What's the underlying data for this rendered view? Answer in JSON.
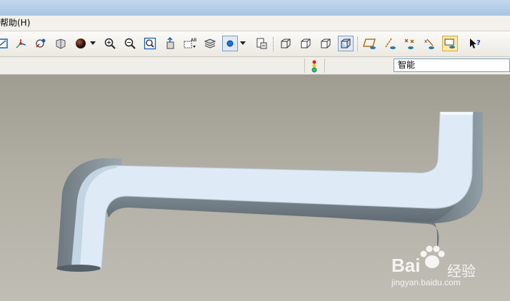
{
  "menu": {
    "help_label": "帮助(H)"
  },
  "toolbar": {
    "icons": [
      "sketch-icon",
      "datum-axis-icon",
      "spin-center-icon",
      "shading-icon",
      "appearance-sphere-icon",
      "zoom-in-icon",
      "zoom-out-icon",
      "refit-icon",
      "named-view-icon",
      "annotation-icon",
      "layers-icon",
      "spin-point-icon",
      "saved-view-icon",
      "wireframe-icon",
      "hidden-line-icon",
      "no-hidden-icon",
      "shaded-cube-icon",
      "datum-plane-display-icon",
      "datum-axis-display-icon",
      "point-display-icon",
      "csys-display-icon",
      "annotation-display-icon",
      "whats-this-icon"
    ]
  },
  "status": {
    "filter_value": "智能"
  },
  "viewport": {
    "shape": "bent-tube-3d-model"
  },
  "watermark": {
    "brand": "Bai",
    "brand_cn": "经验",
    "url": "jingyan.baidu.com"
  },
  "colors": {
    "tube_face": "#deecf8",
    "tube_side": "#7e8a93",
    "background": "#a8a59b"
  }
}
